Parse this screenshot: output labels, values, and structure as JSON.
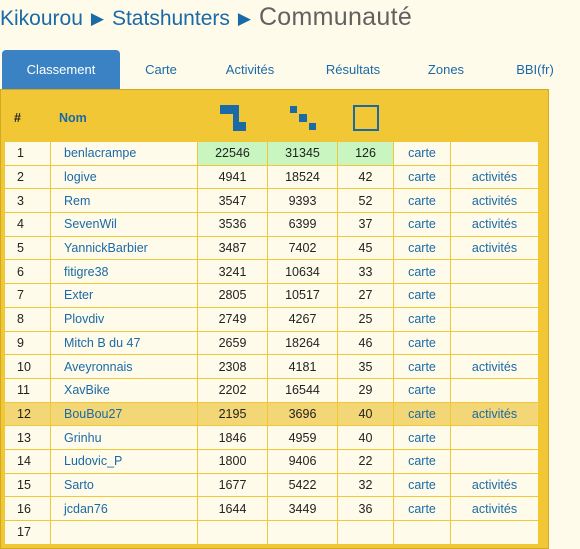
{
  "breadcrumb": {
    "root": "Kikourou",
    "section": "Statshunters",
    "current": "Communauté",
    "separator": "▶"
  },
  "tabs": [
    "Classement",
    "Carte",
    "Activités",
    "Résultats",
    "Zones",
    "BBI(fr)"
  ],
  "active_tab": "Classement",
  "table": {
    "headers": {
      "rank": "#",
      "name": "Nom"
    },
    "header_icons": [
      "max-square-tiles-icon",
      "tiles-icon",
      "max-square-icon"
    ],
    "colors": {
      "icon_blue": "#1a6aa8",
      "leader_bg": "#c8f5c0",
      "highlight_bg": "#f3d675",
      "frame": "#f1c736"
    },
    "rows": [
      {
        "rank": "1",
        "name": "benlacrampe",
        "v1": "22546",
        "v2": "31345",
        "v3": "126",
        "map": "carte",
        "act": ""
      },
      {
        "rank": "2",
        "name": "logive",
        "v1": "4941",
        "v2": "18524",
        "v3": "42",
        "map": "carte",
        "act": "activités"
      },
      {
        "rank": "3",
        "name": "Rem",
        "v1": "3547",
        "v2": "9393",
        "v3": "52",
        "map": "carte",
        "act": "activités"
      },
      {
        "rank": "4",
        "name": "SevenWil",
        "v1": "3536",
        "v2": "6399",
        "v3": "37",
        "map": "carte",
        "act": "activités"
      },
      {
        "rank": "5",
        "name": "YannickBarbier",
        "v1": "3487",
        "v2": "7402",
        "v3": "45",
        "map": "carte",
        "act": "activités"
      },
      {
        "rank": "6",
        "name": "fitigre38",
        "v1": "3241",
        "v2": "10634",
        "v3": "33",
        "map": "carte",
        "act": ""
      },
      {
        "rank": "7",
        "name": "Exter",
        "v1": "2805",
        "v2": "10517",
        "v3": "27",
        "map": "carte",
        "act": ""
      },
      {
        "rank": "8",
        "name": "Plovdiv",
        "v1": "2749",
        "v2": "4267",
        "v3": "25",
        "map": "carte",
        "act": ""
      },
      {
        "rank": "9",
        "name": "Mitch B du 47",
        "v1": "2659",
        "v2": "18264",
        "v3": "46",
        "map": "carte",
        "act": ""
      },
      {
        "rank": "10",
        "name": "Aveyronnais",
        "v1": "2308",
        "v2": "4181",
        "v3": "35",
        "map": "carte",
        "act": "activités"
      },
      {
        "rank": "11",
        "name": "XavBike",
        "v1": "2202",
        "v2": "16544",
        "v3": "29",
        "map": "carte",
        "act": ""
      },
      {
        "rank": "12",
        "name": "BouBou27",
        "v1": "2195",
        "v2": "3696",
        "v3": "40",
        "map": "carte",
        "act": "activités"
      },
      {
        "rank": "13",
        "name": "Grinhu",
        "v1": "1846",
        "v2": "4959",
        "v3": "40",
        "map": "carte",
        "act": ""
      },
      {
        "rank": "14",
        "name": "Ludovic_P",
        "v1": "1800",
        "v2": "9406",
        "v3": "22",
        "map": "carte",
        "act": ""
      },
      {
        "rank": "15",
        "name": "Sarto",
        "v1": "1677",
        "v2": "5422",
        "v3": "32",
        "map": "carte",
        "act": "activités"
      },
      {
        "rank": "16",
        "name": "jcdan76",
        "v1": "1644",
        "v2": "3449",
        "v3": "36",
        "map": "carte",
        "act": "activités"
      },
      {
        "rank": "17",
        "name": "",
        "v1": "",
        "v2": "",
        "v3": "",
        "map": "",
        "act": ""
      }
    ],
    "highlighted_rank": "12",
    "leader_rank": "1"
  }
}
